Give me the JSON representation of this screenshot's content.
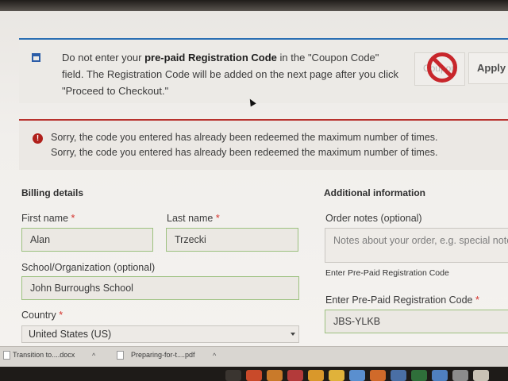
{
  "notice": {
    "before_bold": "Do not enter your ",
    "bold": "pre-paid Registration Code",
    "after_bold": " in the \"Coupon Code\" field. The Registration Code will be added on the next page after you click \"Proceed to Checkout.\""
  },
  "coupon": {
    "label": "Coupon",
    "apply_label": "Apply C"
  },
  "errors": [
    "Sorry, the code you entered has already been redeemed the maximum number of times.",
    "Sorry, the code you entered has already been redeemed the maximum number of times."
  ],
  "billing": {
    "title": "Billing details",
    "first_name_label": "First name",
    "first_name": "Alan",
    "last_name_label": "Last name",
    "last_name": "Trzecki",
    "school_label": "School/Organization (optional)",
    "school": "John Burroughs School",
    "country_label": "Country",
    "country": "United States (US)"
  },
  "additional": {
    "title": "Additional information",
    "order_notes_label": "Order notes (optional)",
    "order_notes_placeholder": "Notes about your order, e.g. special note",
    "prepaid_small_label": "Enter Pre-Paid Registration Code",
    "prepaid_label": "Enter Pre-Paid Registration Code",
    "prepaid_code": "JBS-YLKB"
  },
  "required_mark": "*",
  "downloads": [
    {
      "name": "Transition to....docx",
      "chevron": "^"
    },
    {
      "name": "Preparing-for-t....pdf",
      "chevron": "^"
    }
  ],
  "colors": {
    "info_accent": "#2b6fb3",
    "error_accent": "#b8322e",
    "required": "#d4322c",
    "field_border": "#9cc17f"
  },
  "icons": [
    "info-icon",
    "error-icon",
    "no-entry-icon",
    "chevron-down-icon",
    "mouse-cursor-icon"
  ]
}
